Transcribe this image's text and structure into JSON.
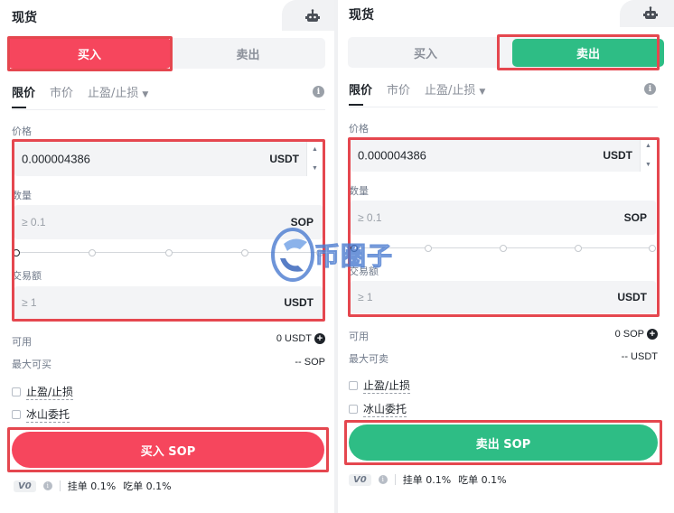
{
  "buy_panel": {
    "title": "现货",
    "side_tabs": {
      "buy": "买入",
      "sell": "卖出",
      "active": "buy"
    },
    "order_types": [
      "限价",
      "市价",
      "止盈/止损"
    ],
    "price": {
      "label": "价格",
      "value": "0.000004386",
      "unit": "USDT"
    },
    "quantity": {
      "label": "数量",
      "placeholder": "≥ 0.1",
      "unit": "SOP"
    },
    "amount": {
      "label": "交易额",
      "placeholder": "≥ 1",
      "unit": "USDT"
    },
    "available": {
      "label": "可用",
      "value": "0 USDT"
    },
    "max": {
      "label": "最大可买",
      "value": "-- SOP"
    },
    "options": [
      "止盈/止损",
      "冰山委托"
    ],
    "submit": "买入 SOP",
    "fees": {
      "vip": "V0",
      "maker": "挂单 0.1%",
      "taker": "吃单 0.1%"
    }
  },
  "sell_panel": {
    "title": "现货",
    "side_tabs": {
      "buy": "买入",
      "sell": "卖出",
      "active": "sell"
    },
    "order_types": [
      "限价",
      "市价",
      "止盈/止损"
    ],
    "price": {
      "label": "价格",
      "value": "0.000004386",
      "unit": "USDT"
    },
    "quantity": {
      "label": "数量",
      "placeholder": "≥ 0.1",
      "unit": "SOP"
    },
    "amount": {
      "label": "交易额",
      "placeholder": "≥ 1",
      "unit": "USDT"
    },
    "available": {
      "label": "可用",
      "value": "0 SOP"
    },
    "max": {
      "label": "最大可卖",
      "value": "-- USDT"
    },
    "options": [
      "止盈/止损",
      "冰山委托"
    ],
    "submit": "卖出 SOP",
    "fees": {
      "vip": "V0",
      "maker": "挂单 0.1%",
      "taker": "吃单 0.1%"
    }
  },
  "watermark": "币圈子",
  "colors": {
    "buy": "#f6465d",
    "sell": "#2ebd85",
    "highlight": "#e5474f"
  },
  "icons": [
    "robot-icon",
    "info-icon",
    "plus-circle-icon",
    "chevron-down-icon"
  ]
}
